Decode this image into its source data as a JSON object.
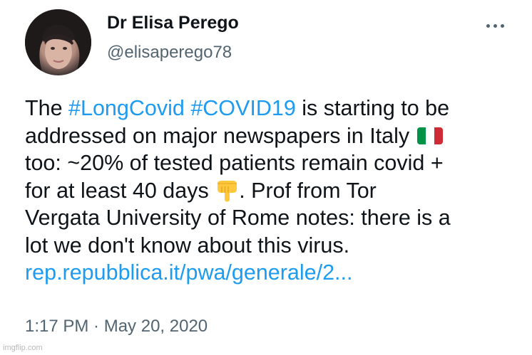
{
  "author": {
    "display_name": "Dr Elisa Perego",
    "handle": "@elisaperego78"
  },
  "tweet": {
    "line1": {
      "prefix": "The ",
      "hashtag1": "#LongCovid",
      "space": " ",
      "hashtag2": "#COVID19",
      "suffix": " is starting to be"
    },
    "line2": {
      "text": "addressed on major newspapers in Italy "
    },
    "line3": {
      "text": "too: ~20% of tested patients remain covid +"
    },
    "line4": {
      "prefix": "for at least 40 days ",
      "suffix": ". Prof from Tor"
    },
    "line5": {
      "text": "Vergata University of Rome notes: there is a"
    },
    "line6": {
      "text": "lot we don't know about this virus."
    },
    "link": "rep.repubblica.it/pwa/generale/2...",
    "timestamp": "1:17 PM · May 20, 2020"
  },
  "icons": {
    "more": "more-horizontal-icon",
    "flag": "italy-flag-icon",
    "pointing": "backhand-index-pointing-down-icon"
  },
  "colors": {
    "link": "#1d9bf0",
    "secondary_text": "#536471",
    "primary_text": "#0f1419",
    "flag_green": "#009246",
    "flag_white": "#ffffff",
    "flag_red": "#ce2b37",
    "emoji_yellow": "#ffc83d"
  },
  "watermark": "imgflip.com"
}
